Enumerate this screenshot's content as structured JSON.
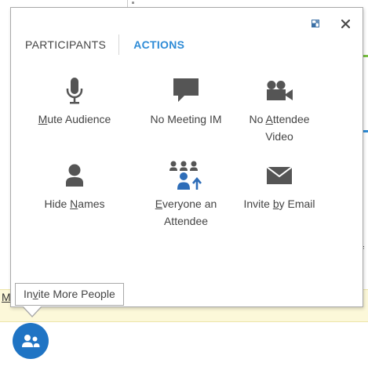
{
  "background": {
    "partial_char": "f",
    "partial_link": "M"
  },
  "window": {
    "popout_icon": "popout-icon",
    "close_icon": "close-icon"
  },
  "tabs": {
    "participants": "PARTICIPANTS",
    "actions": "ACTIONS",
    "active": "actions"
  },
  "actions": {
    "mute_audience": {
      "icon": "microphone-icon",
      "accel": "M",
      "rest": "ute Audience"
    },
    "no_meeting_im": {
      "icon": "speech-bubble-icon",
      "label": "No Meeting IM"
    },
    "no_attendee_video": {
      "icon": "video-camera-icon",
      "pre": "No ",
      "accel": "A",
      "rest": "ttendee",
      "line2": "Video"
    },
    "hide_names": {
      "icon": "person-icon",
      "pre": "Hide ",
      "accel": "N",
      "rest": "ames"
    },
    "everyone_attendee": {
      "icon": "group-attendee-icon",
      "accel": "E",
      "rest": "veryone an",
      "line2": "Attendee"
    },
    "invite_by_email": {
      "icon": "envelope-icon",
      "pre": "Invite ",
      "accel": "b",
      "rest": "y Email"
    }
  },
  "invite_more": {
    "pre": "In",
    "accel": "v",
    "rest": "ite More People"
  },
  "people_button": {
    "icon": "people-icon"
  },
  "colors": {
    "accent": "#2e8bd6",
    "icon": "#555555",
    "people_button": "#1f74c4",
    "text": "#444444"
  }
}
